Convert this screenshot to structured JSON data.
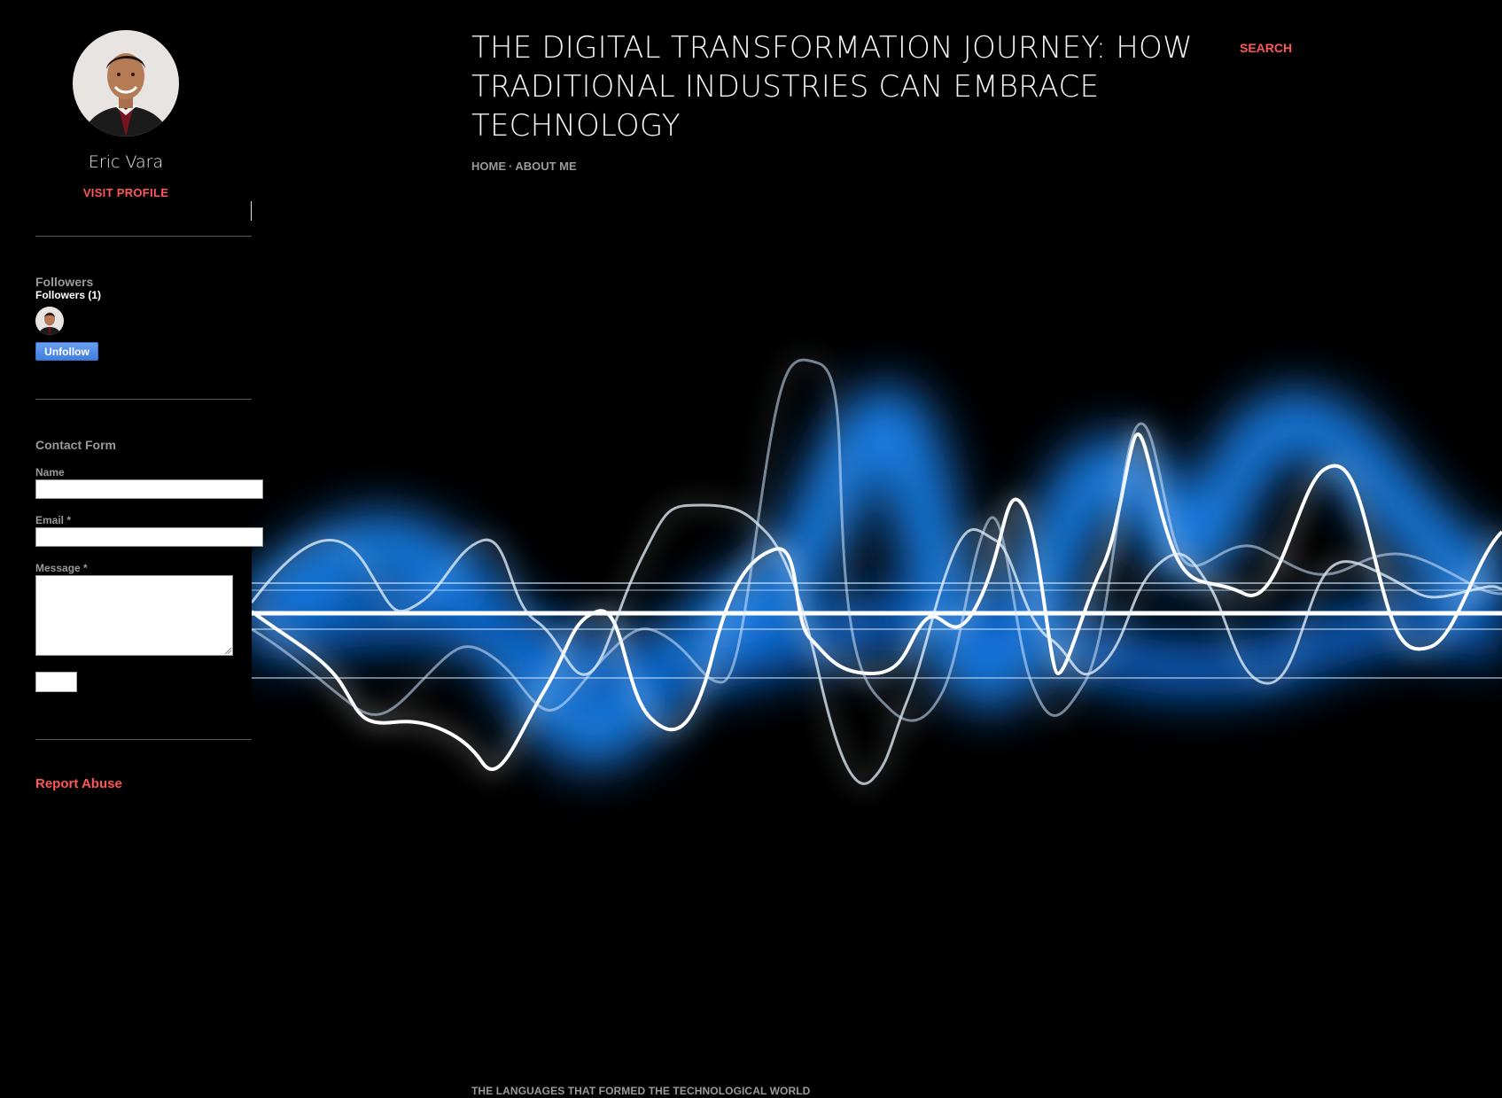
{
  "header": {
    "title": "THE DIGITAL TRANSFORMATION JOURNEY: HOW TRADITIONAL INDUSTRIES CAN EMBRACE TECHNOLOGY",
    "search_label": "SEARCH",
    "nav": {
      "home": "HOME",
      "separator": "·",
      "about": "ABOUT ME"
    }
  },
  "profile": {
    "name": "Eric Vara",
    "visit_label": "VISIT PROFILE"
  },
  "followers": {
    "title": "Followers",
    "count_label": "Followers (1)",
    "unfollow_label": "Unfollow"
  },
  "contact_form": {
    "title": "Contact Form",
    "name_label": "Name",
    "email_label": "Email *",
    "message_label": "Message *"
  },
  "report_abuse": "Report Abuse",
  "posts": {
    "next_title": "THE LANGUAGES THAT FORMED THE TECHNOLOGICAL WORLD"
  },
  "colors": {
    "background": "#000000",
    "accent": "#ff5656",
    "glow": "#1ea0ff",
    "follow_button": "#4a86e8"
  }
}
